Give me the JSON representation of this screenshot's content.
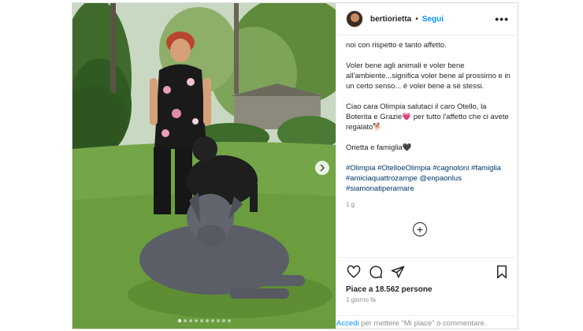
{
  "post": {
    "username": "bertiorietta",
    "follow_label": "Segui",
    "more_label": "•••",
    "caption_paragraphs": [
      "noi con rispetto e tanto affetto.",
      "Voler bene agli animali e voler bene all'ambiente...significa voler bene al prossimo e in un certo senso... è voler bene a sé stessi.",
      "Ciao cara Olimpia salutaci il caro Otello, la Boterita e Grazie💗 per tutto l'affetto che ci avete regalato🐕",
      "Orietta e famiglia🖤"
    ],
    "hashtags": "#Olimpia #OtelloeOlimpia #cagnoloni #famiglia #amiciaquattrozampe @enpaonlus #siamonatiperamare",
    "time_ago": "1 g",
    "add_comment_icon": "+",
    "likes": "Piace a 18.562 persone",
    "date": "1 giorno fa",
    "login_link": "Accedi",
    "login_text": " per mettere \"Mi piace\" o commentare.",
    "carousel": {
      "slides": 10,
      "active_index": 0
    },
    "icons": [
      "heart-icon",
      "comment-icon",
      "share-icon",
      "bookmark-icon",
      "chevron-right-icon",
      "plus-circle-icon"
    ]
  }
}
